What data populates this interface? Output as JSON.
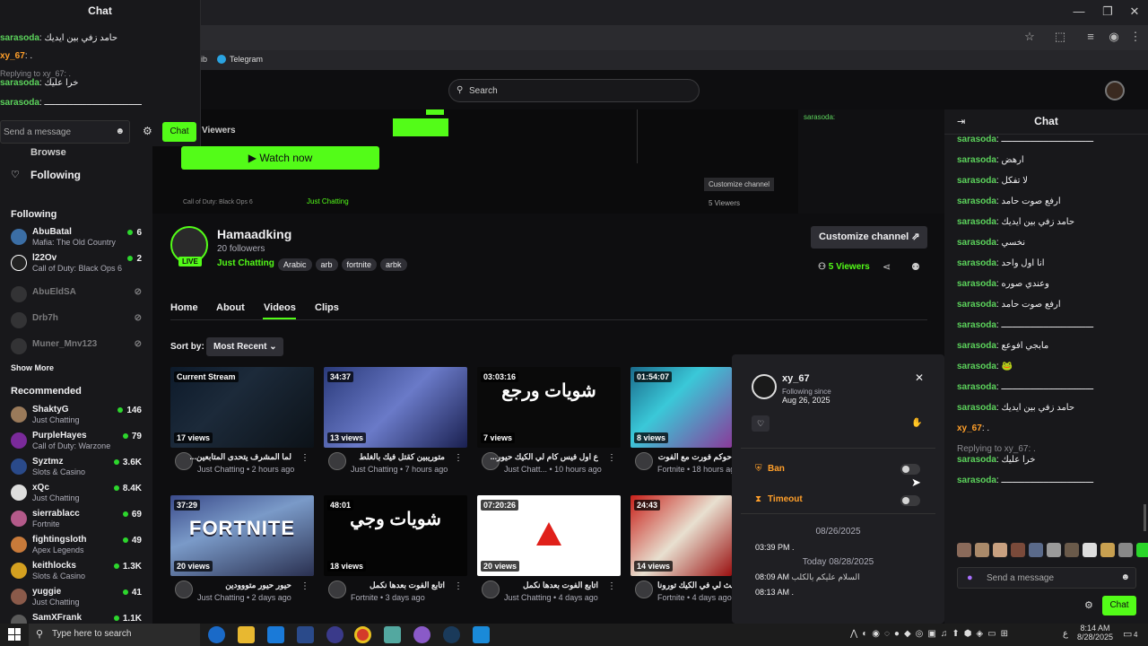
{
  "popout_chat": {
    "title": "Chat",
    "messages": [
      {
        "user": "sarasoda",
        "sep": ":",
        "text": "حامد زفي بين ايديك",
        "reply": ""
      },
      {
        "user": "xy_67",
        "sep": ":",
        "text": ".",
        "reply": ""
      },
      {
        "user": "sarasoda",
        "sep": ":",
        "text": "خرا عليك",
        "reply": "Replying to xy_67: ."
      },
      {
        "user": "sarasoda",
        "sep": ":",
        "text": "ـــــــــــــــــــــــــــــــــــــ",
        "reply": ""
      }
    ],
    "input_placeholder": "Send a message",
    "chat_button": "Chat"
  },
  "bookmarks": {
    "item_partial": "ib",
    "telegram": "Telegram"
  },
  "search": {
    "placeholder": "Search"
  },
  "sidebar": {
    "browse": "Browse",
    "following_nav": "Following",
    "following_header": "Following",
    "following": [
      {
        "name": "AbuBatal",
        "category": "Mafia: The Old Country",
        "count": "6",
        "color": "#3b6ea5"
      },
      {
        "name": "l22Ov",
        "category": "Call of Duty: Black Ops 6",
        "count": "2",
        "color": "#222"
      },
      {
        "name": "AbuEldSA",
        "category": "",
        "count": "",
        "color": "#555"
      },
      {
        "name": "Drb7h",
        "category": "",
        "count": "",
        "color": "#555"
      },
      {
        "name": "Muner_Mnv123",
        "category": "",
        "count": "",
        "color": "#555"
      }
    ],
    "show_more": "Show More",
    "recommended_header": "Recommended",
    "recommended": [
      {
        "name": "ShaktyG",
        "category": "Just Chatting",
        "count": "146",
        "color": "#9a7a5a"
      },
      {
        "name": "PurpleHayes",
        "category": "Call of Duty: Warzone",
        "count": "79",
        "color": "#7a2a9a"
      },
      {
        "name": "Syztmz",
        "category": "Slots & Casino",
        "count": "3.6K",
        "color": "#2a4a8a"
      },
      {
        "name": "xQc",
        "category": "Just Chatting",
        "count": "8.4K",
        "color": "#ddd"
      },
      {
        "name": "sierrablacc",
        "category": "Fortnite",
        "count": "69",
        "color": "#b45a8a"
      },
      {
        "name": "fightingsloth",
        "category": "Apex Legends",
        "count": "49",
        "color": "#c87a3a"
      },
      {
        "name": "keithlocks",
        "category": "Slots & Casino",
        "count": "1.3K",
        "color": "#d4a020"
      },
      {
        "name": "yuggie",
        "category": "Just Chatting",
        "count": "41",
        "color": "#8a5a4a"
      },
      {
        "name": "SamXFrank",
        "category": "",
        "count": "1.1K",
        "color": "#5a5a5a"
      }
    ]
  },
  "banner": {
    "viewers_label": "Viewers",
    "watch_now": "Watch now",
    "customize_small": "Customize channel",
    "mini_game": "Call of Duty: Black Ops 6",
    "mini_cat": "Just Chatting",
    "mini_tags": [
      "Arabic",
      "arb",
      "fortnite",
      "arbk"
    ],
    "mini_viewers": "5 Viewers"
  },
  "channel": {
    "name": "Hamaadking",
    "followers": "20 followers",
    "category": "Just Chatting",
    "tags": [
      "Arabic",
      "arb",
      "fortnite",
      "arbk"
    ],
    "live": "LIVE",
    "customize": "Customize channel",
    "viewers": "5 Viewers"
  },
  "tabs": [
    "Home",
    "About",
    "Videos",
    "Clips"
  ],
  "sort": {
    "label": "Sort by:",
    "value": "Most Recent"
  },
  "videos": [
    {
      "badge": "Current Stream",
      "views": "17 views",
      "title": "...لما المشرف يتحدى المتابعين",
      "meta": "Just Chatting • 2 hours ago",
      "bg": "linear-gradient(135deg,#0d1a2a,#1c2a3a 40%,#0c1218)",
      "overlay": ""
    },
    {
      "badge": "34:37",
      "views": "13 views",
      "title": "متوريبين كقتل فيك بالغلط",
      "meta": "Just Chatting • 7 hours ago",
      "bg": "linear-gradient(135deg,#2a3a7a,#6a7ac8 50%,#1a2050)",
      "overlay": ""
    },
    {
      "badge": "03:03:16",
      "views": "7 views",
      "title": "...ع اول فيس كام لي الكيك حيور",
      "meta": "Just Chatt... • 10 hours ago",
      "bg": "#0a0a0a",
      "overlay": "شويات ورجع"
    },
    {
      "badge": "01:54:07",
      "views": "8 views",
      "title": "حوكم فورت مع الفوت",
      "meta": "Fortnite • 18 hours ago",
      "bg": "linear-gradient(135deg,#1a6a8a,#3ac8d8 40%,#8a3a9a)",
      "overlay": ""
    },
    {
      "badge": "37:29",
      "views": "20 views",
      "title": "حيور حيور متووودين",
      "meta": "Just Chatting • 2 days ago",
      "bg": "linear-gradient(160deg,#3a4a8a,#7a9ac8 40%,#2a3050)",
      "overlay": "FORTNITE"
    },
    {
      "badge": "48:01",
      "views": "18 views",
      "title": "اتابع الفوت بعدها نكمل",
      "meta": "Fortnite • 3 days ago",
      "bg": "#050505",
      "overlay": "شويات وجي"
    },
    {
      "badge": "07:20:26",
      "views": "20 views",
      "title": "اتابع الفوت بعدها نكمل",
      "meta": "Just Chatting • 4 days ago",
      "bg": "#ffffff",
      "overlay": ""
    },
    {
      "badge": "24:43",
      "views": "14 views",
      "title": "بث لي في الكيك تورونا",
      "meta": "Fortnite • 4 days ago",
      "bg": "linear-gradient(135deg,#c8201a,#e8e0d0 50%,#9a1010)",
      "overlay": ""
    }
  ],
  "chat": {
    "title": "Chat",
    "messages": [
      {
        "user": "sarasoda",
        "text": "ـــــــــــــــــــــــــــــــــــ",
        "reply": ""
      },
      {
        "user": "sarasoda",
        "text": "ارهض",
        "reply": ""
      },
      {
        "user": "sarasoda",
        "text": "لا تفكل",
        "reply": ""
      },
      {
        "user": "sarasoda",
        "text": "ارفع صوت حامد",
        "reply": ""
      },
      {
        "user": "sarasoda",
        "text": "حامد زفي بين ايديك",
        "reply": ""
      },
      {
        "user": "sarasoda",
        "text": "نخسي",
        "reply": ""
      },
      {
        "user": "sarasoda",
        "text": "انا اول واحد",
        "reply": ""
      },
      {
        "user": "sarasoda",
        "text": "وعندي صوره",
        "reply": ""
      },
      {
        "user": "sarasoda",
        "text": "ارفع صوت حامد",
        "reply": ""
      },
      {
        "user": "sarasoda",
        "text": "ـــــــــــــــــــــــــــــــــــ",
        "reply": ""
      },
      {
        "user": "sarasoda",
        "text": "مابجي افوعع",
        "reply": ""
      },
      {
        "user": "sarasoda",
        "text": "🐸",
        "reply": ""
      },
      {
        "user": "sarasoda",
        "text": "ـــــــــــــــــــــــــــــــــــ",
        "reply": ""
      },
      {
        "user": "sarasoda",
        "text": "حامد زفي بين ايديك",
        "reply": ""
      },
      {
        "user": "xy_67",
        "text": ".",
        "reply": ""
      },
      {
        "user": "sarasoda",
        "text": "خرا عليك",
        "reply": "Replying to xy_67: ."
      },
      {
        "user": "sarasoda",
        "text": "ـــــــــــــــــــــــــــــــــــ",
        "reply": ""
      }
    ],
    "input_placeholder": "Send a message",
    "chat_button": "Chat"
  },
  "user_card": {
    "username": "xy_67",
    "following_since_label": "Following since",
    "following_since_date": "Aug 26, 2025",
    "ban": "Ban",
    "timeout": "Timeout",
    "date_header": "08/26/2025",
    "log1_time": "03:39 PM",
    "log1_text": ".",
    "today_header": "Today 08/28/2025",
    "log2_time": "08:09 AM",
    "log2_text": "السلام عليكم يالكلب",
    "log3_time": "08:13 AM",
    "log3_text": "."
  },
  "taskbar": {
    "search_placeholder": "Type here to search",
    "time": "8:14 AM",
    "date": "8/28/2025",
    "lang": "ع",
    "notif": "4"
  }
}
